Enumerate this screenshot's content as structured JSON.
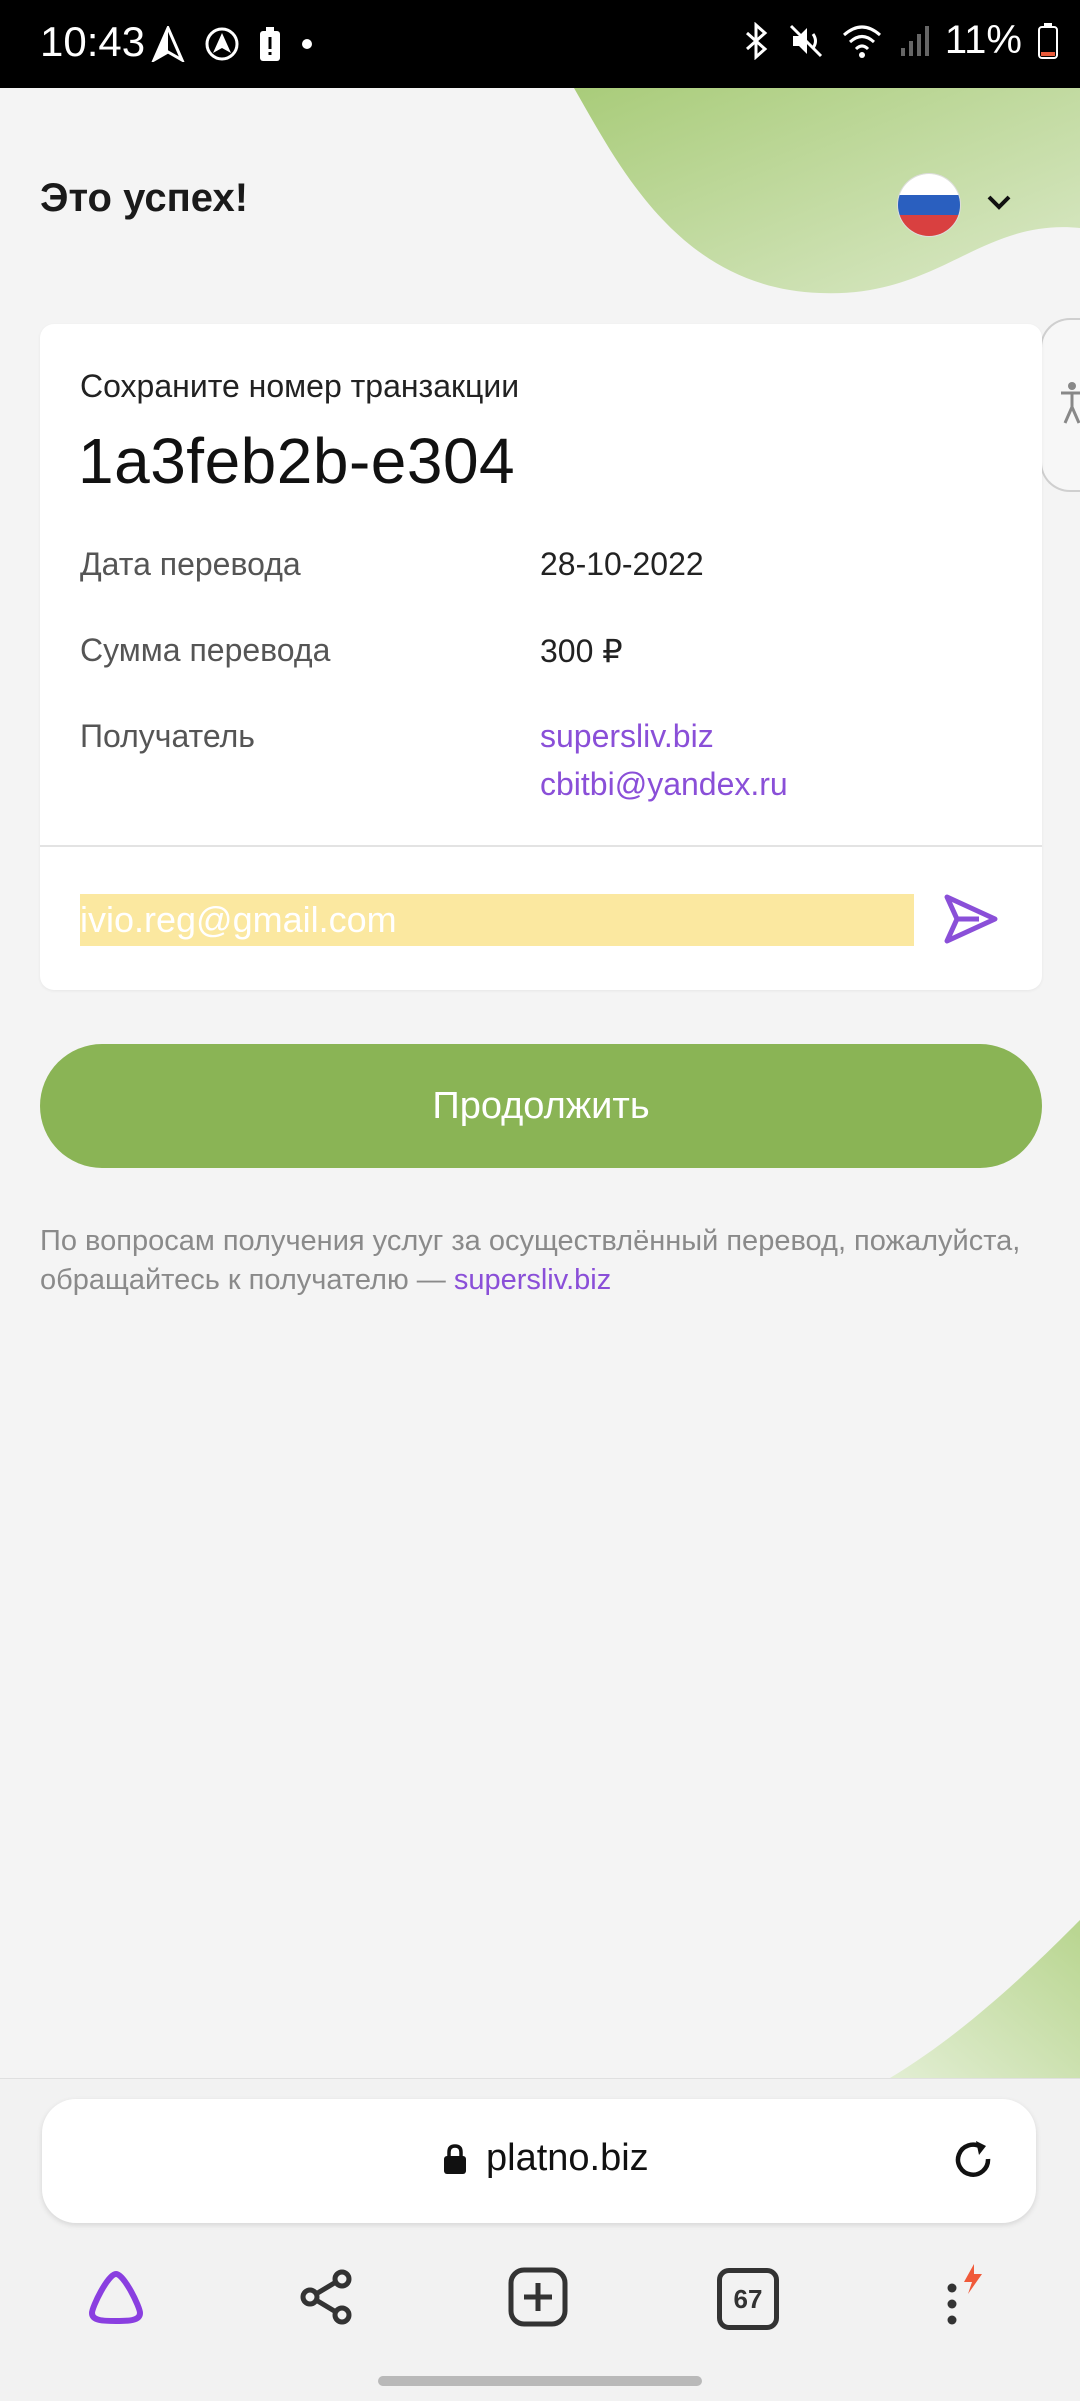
{
  "status_bar": {
    "time": "10:43",
    "battery": "11%"
  },
  "header": {
    "title": "Это успех!",
    "language_icon": "russia-flag-icon"
  },
  "card": {
    "caption": "Сохраните номер транзакции",
    "transaction_id": "1a3feb2b-e304",
    "rows": [
      {
        "label": "Дата перевода",
        "value": "28-10-2022"
      },
      {
        "label": "Сумма перевода",
        "value": "300 ₽"
      },
      {
        "label": "Получатель",
        "value": "supersliv.biz",
        "value2": "cbitbi@yandex.ru"
      }
    ],
    "email_value": "ivio.reg@gmail.com"
  },
  "continue_label": "Продолжить",
  "note": {
    "text": "По вопросам получения услуг за осуществлённый перевод, пожалуйста, обращайтесь к получателю —",
    "link": "supersliv.biz"
  },
  "browser": {
    "url": "platno.biz",
    "tabs_count": "67"
  },
  "colors": {
    "accent_green": "#8ab455",
    "link_purple": "#8a4fd8",
    "highlight_yellow": "#fbe8a0"
  }
}
